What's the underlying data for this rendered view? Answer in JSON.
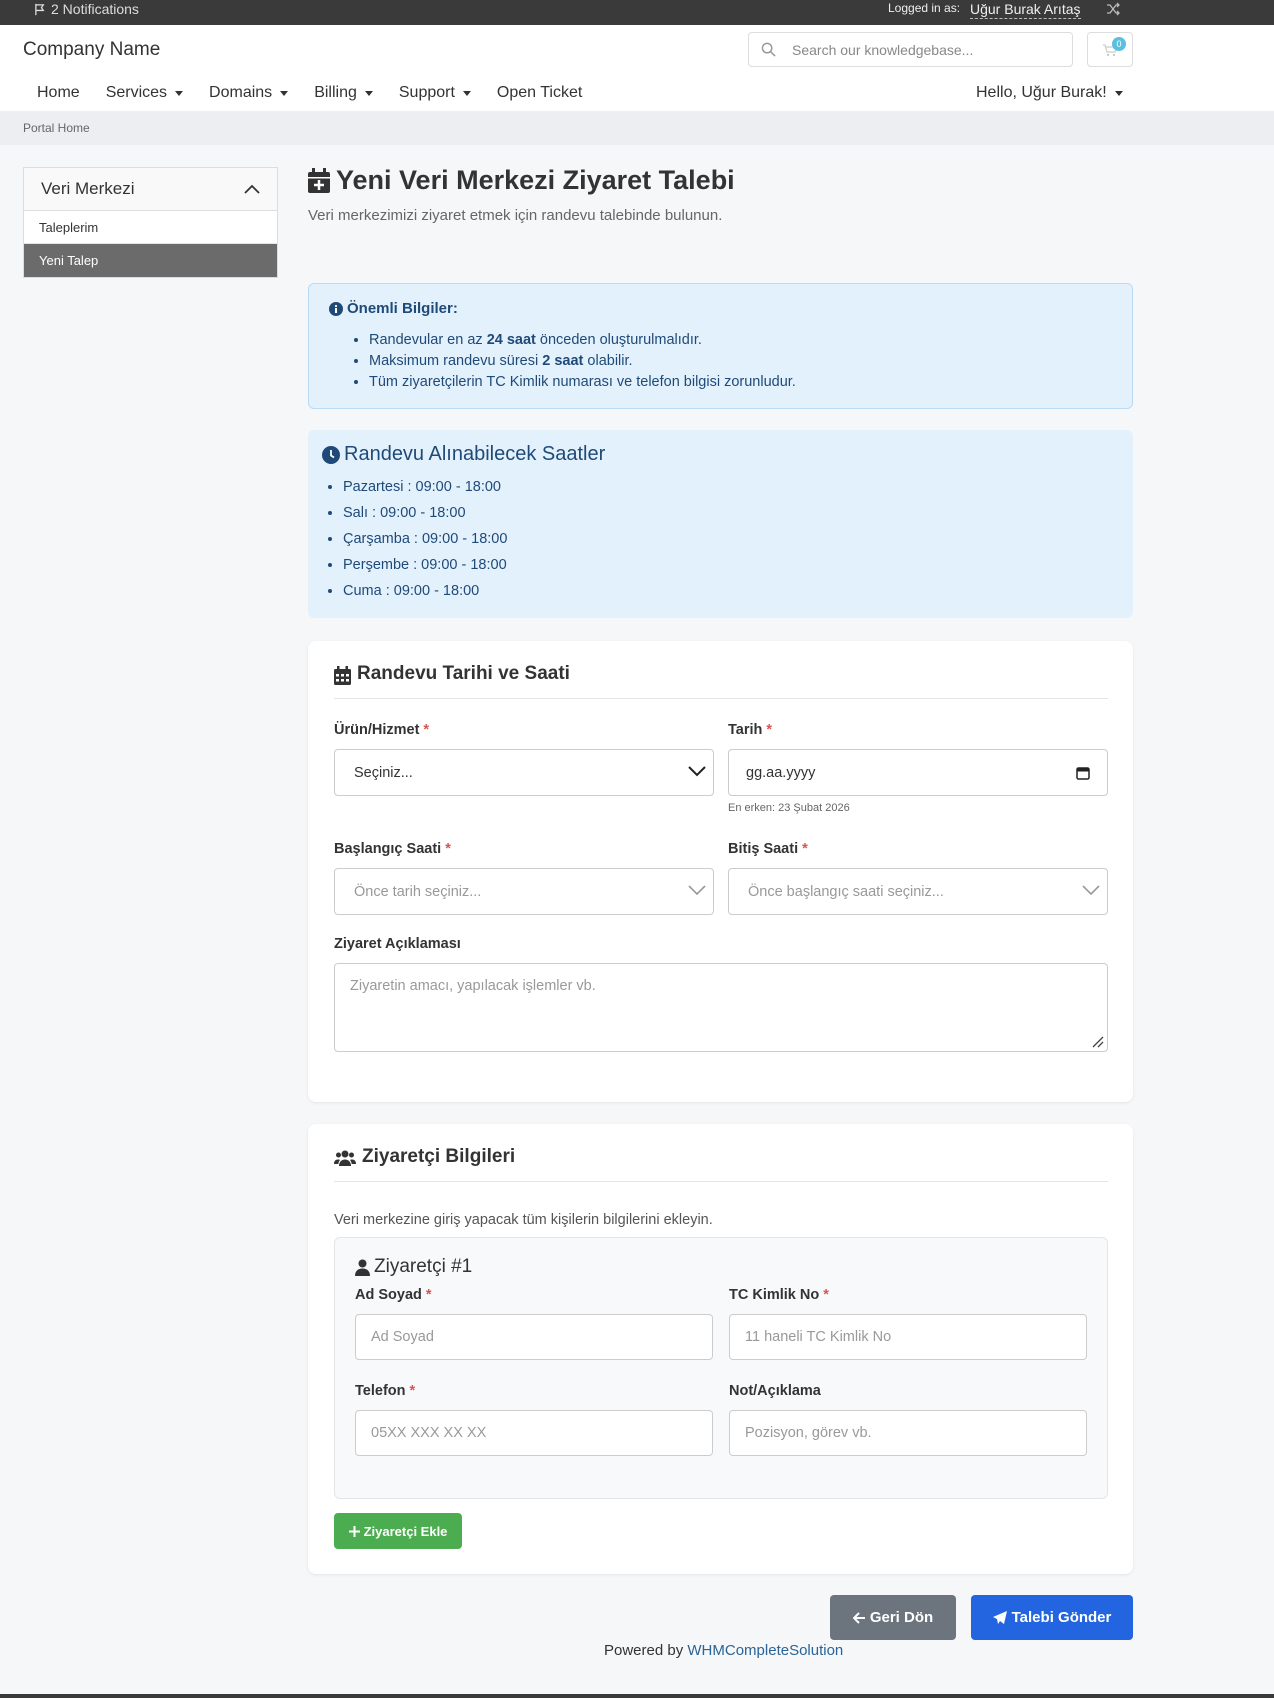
{
  "topbar": {
    "notifications": "2 Notifications",
    "logged_in_label": "Logged in as:",
    "user_name": "Uğur Burak Arıtaş"
  },
  "header": {
    "brand": "Company Name",
    "search_placeholder": "Search our knowledgebase...",
    "cart_count": "0"
  },
  "nav": {
    "items": [
      "Home",
      "Services",
      "Domains",
      "Billing",
      "Support",
      "Open Ticket"
    ],
    "greeting": "Hello, Uğur Burak!"
  },
  "breadcrumb": "Portal Home",
  "sidebar": {
    "title": "Veri Merkezi",
    "items": [
      "Taleplerim",
      "Yeni Talep"
    ]
  },
  "page": {
    "title": "Yeni Veri Merkezi Ziyaret Talebi",
    "subtitle": "Veri merkezimizi ziyaret etmek için randevu talebinde bulunun."
  },
  "info": {
    "title": "Önemli Bilgiler:",
    "items": [
      {
        "before": "Randevular en az ",
        "bold": "24 saat",
        "after": " önceden oluşturulmalıdır."
      },
      {
        "before": "Maksimum randevu süresi ",
        "bold": "2 saat",
        "after": " olabilir."
      },
      {
        "before": "Tüm ziyaretçilerin TC Kimlik numarası ve telefon bilgisi zorunludur.",
        "bold": "",
        "after": ""
      }
    ]
  },
  "hours": {
    "title": "Randevu Alınabilecek Saatler",
    "items": [
      "Pazartesi : 09:00 - 18:00",
      "Salı : 09:00 - 18:00",
      "Çarşamba : 09:00 - 18:00",
      "Perşembe : 09:00 - 18:00",
      "Cuma : 09:00 - 18:00"
    ]
  },
  "appointment": {
    "title": "Randevu Tarihi ve Saati",
    "product_label": "Ürün/Hizmet",
    "product_value": "Seçiniz...",
    "date_label": "Tarih",
    "date_value": "gg.aa.yyyy",
    "date_hint": "En erken: 23 Şubat 2026",
    "start_label": "Başlangıç Saati",
    "start_placeholder": "Önce tarih seçiniz...",
    "end_label": "Bitiş Saati",
    "end_placeholder": "Önce başlangıç saati seçiniz...",
    "desc_label": "Ziyaret Açıklaması",
    "desc_placeholder": "Ziyaretin amacı, yapılacak işlemler vb.",
    "required_mark": "*"
  },
  "visitors": {
    "title": "Ziyaretçi Bilgileri",
    "intro": "Veri merkezine giriş yapacak tüm kişilerin bilgilerini ekleyin.",
    "visitor_title": "Ziyaretçi #1",
    "name_label": "Ad Soyad",
    "name_placeholder": "Ad Soyad",
    "tc_label": "TC Kimlik No",
    "tc_placeholder": "11 haneli TC Kimlik No",
    "phone_label": "Telefon",
    "phone_placeholder": "05XX XXX XX XX",
    "note_label": "Not/Açıklama",
    "note_placeholder": "Pozisyon, görev vb.",
    "add_button": "Ziyaretçi Ekle"
  },
  "actions": {
    "back": "Geri Dön",
    "submit": "Talebi Gönder"
  },
  "footer": {
    "powered_by": "Powered by",
    "link": "WHMCompleteSolution"
  },
  "colors": {
    "primary": "#2365e0",
    "success": "#4cad50",
    "secondary": "#6c757d",
    "info_bg": "#e3f1fd",
    "info_text": "#1f4a78",
    "topbar": "#3a3a3a"
  }
}
